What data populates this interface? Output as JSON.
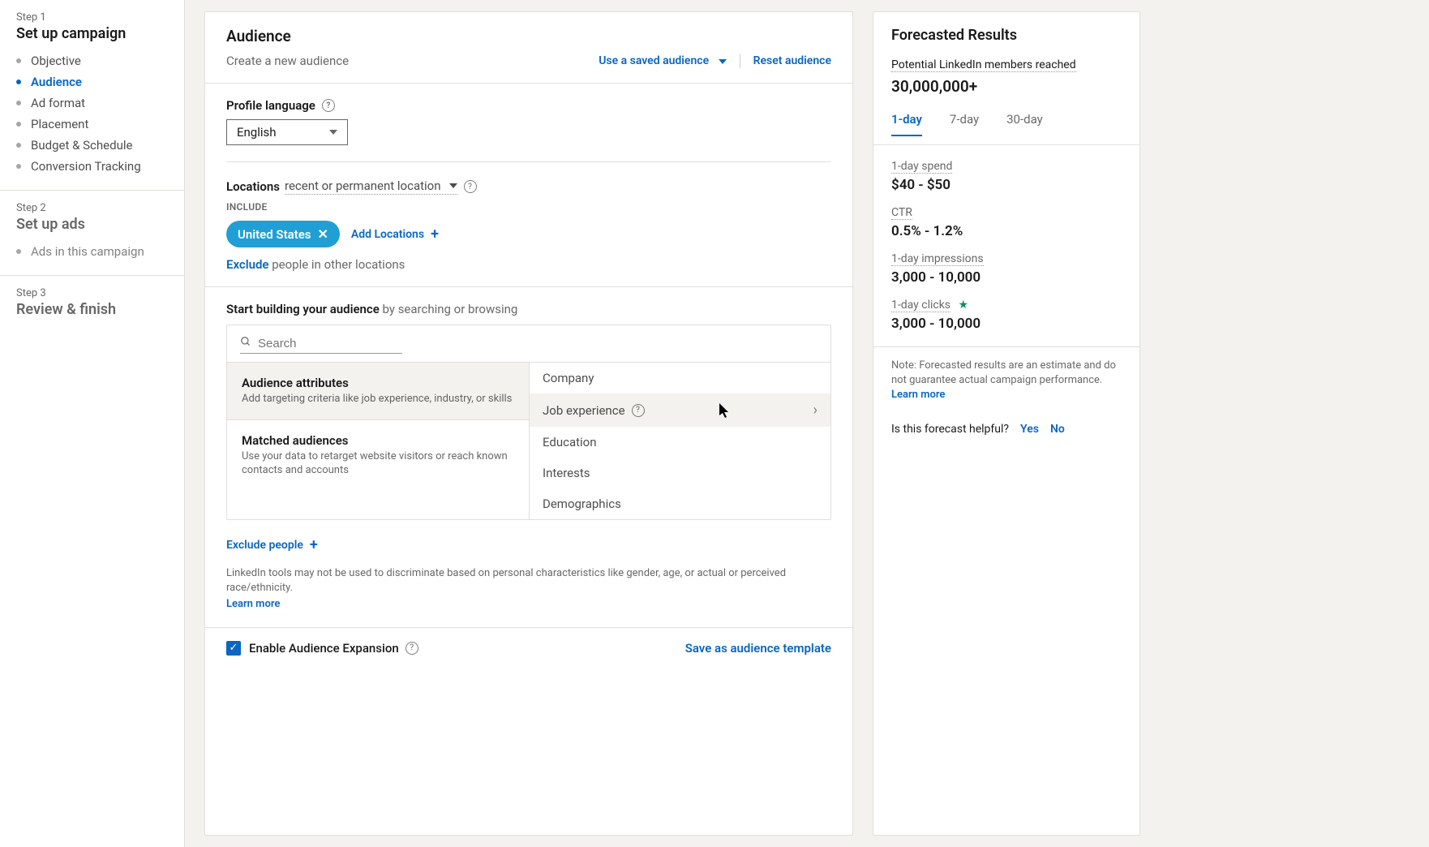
{
  "sidebar": {
    "step1": {
      "label": "Step 1",
      "title": "Set up campaign",
      "items": [
        "Objective",
        "Audience",
        "Ad format",
        "Placement",
        "Budget & Schedule",
        "Conversion Tracking"
      ],
      "activeIndex": 1
    },
    "step2": {
      "label": "Step 2",
      "title": "Set up ads",
      "items": [
        "Ads in this campaign"
      ]
    },
    "step3": {
      "label": "Step 3",
      "title": "Review & finish"
    }
  },
  "audience": {
    "title": "Audience",
    "create": "Create a new audience",
    "use_saved": "Use a saved audience",
    "reset": "Reset audience",
    "profile_language_label": "Profile language",
    "profile_language_value": "English",
    "locations_label": "Locations",
    "locations_mode": "recent or permanent location",
    "include_label": "INCLUDE",
    "location_chip": "United States",
    "add_locations": "Add Locations",
    "exclude_link": "Exclude",
    "exclude_rest": " people in other locations",
    "build_title": "Start building your audience",
    "build_rest": " by searching or browsing",
    "search_placeholder": "Search",
    "attributes": {
      "title": "Audience attributes",
      "desc": "Add targeting criteria like job experience, industry, or skills"
    },
    "matched": {
      "title": "Matched audiences",
      "desc": "Use your data to retarget website visitors or reach known contacts and accounts"
    },
    "right_items": [
      "Company",
      "Job experience",
      "Education",
      "Interests",
      "Demographics"
    ],
    "right_hover_index": 1,
    "exclude_people": "Exclude people",
    "disclaimer": "LinkedIn tools may not be used to discriminate based on personal characteristics like gender, age, or actual or perceived race/ethnicity.",
    "learn_more": "Learn more",
    "expansion_label": "Enable Audience Expansion",
    "save_template": "Save as audience template"
  },
  "forecast": {
    "title": "Forecasted Results",
    "reach_label": "Potential LinkedIn members reached",
    "reach_value": "30,000,000+",
    "tabs": [
      "1-day",
      "7-day",
      "30-day"
    ],
    "tab_active": 0,
    "metrics": [
      {
        "label": "1-day spend",
        "value": "$40 - $50"
      },
      {
        "label": "CTR",
        "value": "0.5% - 1.2%"
      },
      {
        "label": "1-day impressions",
        "value": "3,000 - 10,000"
      },
      {
        "label": "1-day clicks",
        "value": "3,000 - 10,000",
        "star": true
      }
    ],
    "note": "Note: Forecasted results are an estimate and do not guarantee actual campaign performance.",
    "learn_more": "Learn more",
    "helpful": "Is this forecast helpful?",
    "yes": "Yes",
    "no": "No"
  }
}
